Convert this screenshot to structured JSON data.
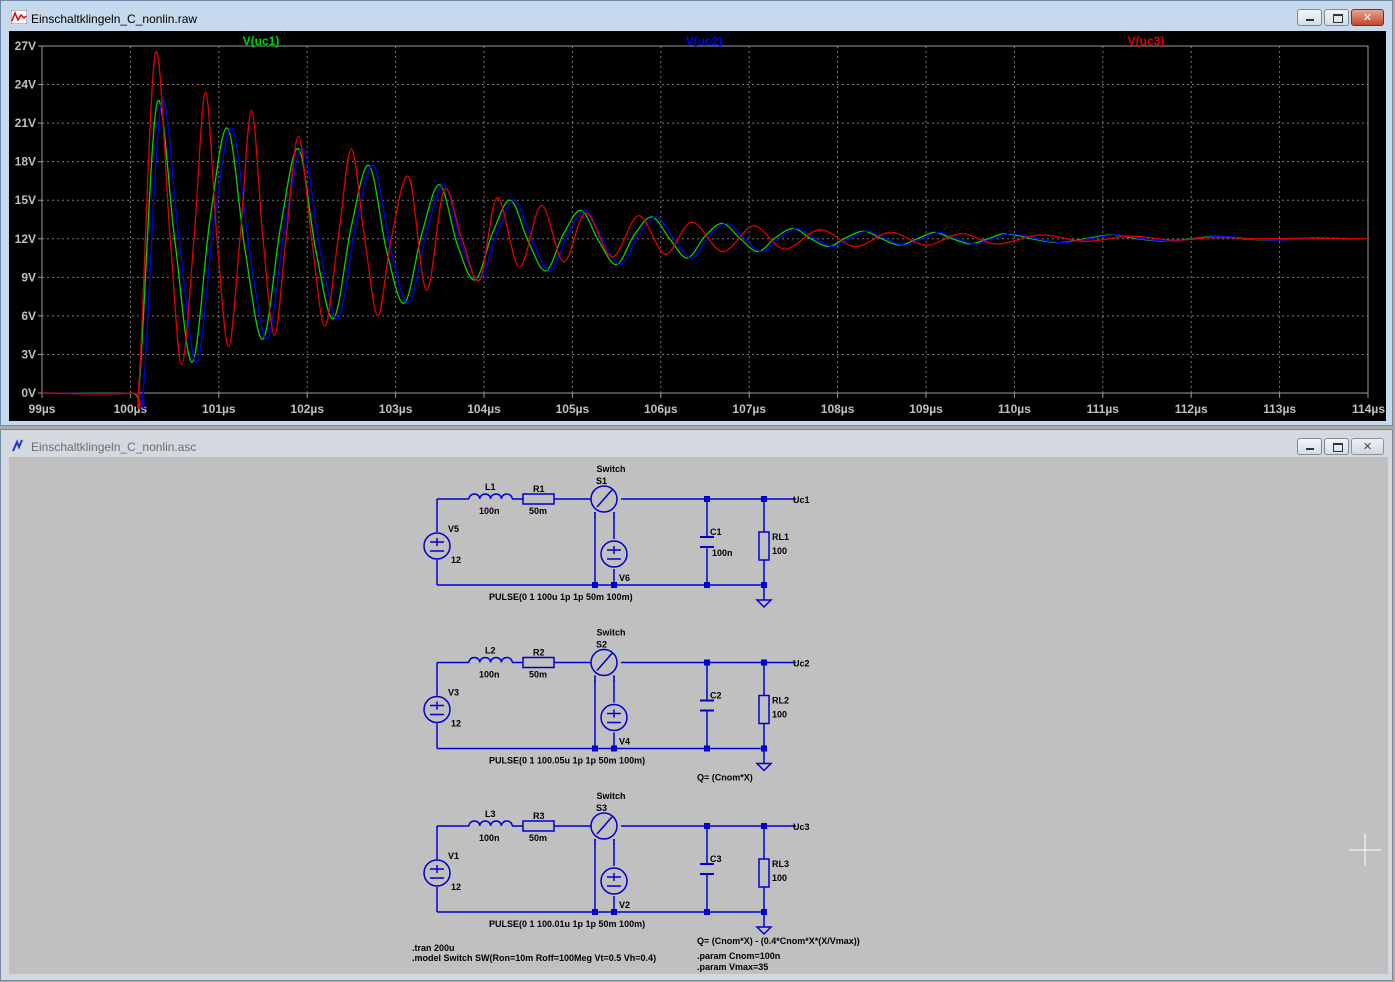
{
  "plot_window": {
    "title": "Einschaltklingeln_C_nonlin.raw",
    "app_icon": "waveform-icon",
    "controls": {
      "minimize": "minimize-icon",
      "maximize": "maximize-icon",
      "close_label": "✕"
    }
  },
  "schematic_window": {
    "title": "Einschaltklingeln_C_nonlin.asc",
    "app_icon": "schematic-icon",
    "controls": {
      "minimize": "minimize-icon",
      "maximize": "maximize-icon",
      "close_label": "✕"
    }
  },
  "chart_data": {
    "type": "line",
    "title": "",
    "xlabel": "",
    "ylabel": "",
    "xlim": [
      99,
      114
    ],
    "ylim": [
      0,
      27
    ],
    "x_unit": "µs",
    "y_unit": "V",
    "x_ticks": [
      "99µs",
      "100µs",
      "101µs",
      "102µs",
      "103µs",
      "104µs",
      "105µs",
      "106µs",
      "107µs",
      "108µs",
      "109µs",
      "110µs",
      "111µs",
      "112µs",
      "113µs",
      "114µs"
    ],
    "y_ticks": [
      "0V",
      "3V",
      "6V",
      "9V",
      "12V",
      "15V",
      "18V",
      "21V",
      "24V",
      "27V"
    ],
    "grid": true,
    "background": "#000000",
    "series": [
      {
        "name": "V(uc1)",
        "color": "#00d400",
        "x": [
          99,
          100.0,
          100.1,
          100.3,
          100.5,
          100.7,
          100.9,
          101.1,
          101.3,
          101.5,
          101.7,
          101.9,
          102.1,
          102.3,
          102.5,
          102.7,
          102.9,
          103.1,
          103.3,
          103.5,
          103.7,
          103.9,
          104.1,
          104.3,
          104.5,
          104.7,
          104.9,
          105.1,
          105.3,
          105.5,
          105.7,
          105.9,
          106.1,
          106.3,
          106.5,
          106.7,
          106.9,
          107.1,
          107.3,
          107.5,
          107.7,
          107.9,
          108.1,
          108.3,
          108.5,
          108.7,
          108.9,
          109.1,
          109.3,
          109.5,
          109.7,
          109.9,
          110.2,
          110.5,
          110.8,
          111.1,
          111.4,
          111.7,
          112.0,
          112.3,
          112.6,
          112.9,
          113.2,
          113.5,
          113.8,
          114
        ],
        "y": [
          0,
          0,
          0.6,
          22.5,
          12.0,
          2.4,
          13.5,
          20.6,
          11.0,
          4.2,
          13.0,
          19.0,
          11.0,
          5.8,
          13.0,
          17.7,
          11.0,
          7.0,
          12.5,
          16.2,
          11.5,
          8.8,
          12.5,
          15.0,
          11.8,
          9.5,
          12.4,
          14.2,
          11.8,
          10.0,
          12.3,
          13.7,
          12.0,
          10.5,
          12.2,
          13.2,
          12.0,
          11.0,
          12.1,
          12.8,
          12.0,
          11.4,
          12.1,
          12.6,
          12.0,
          11.5,
          12.0,
          12.5,
          12.0,
          11.6,
          12.0,
          12.4,
          12.0,
          11.7,
          12.0,
          12.3,
          12.0,
          11.8,
          12.0,
          12.2,
          12.0,
          11.9,
          12.0,
          12.1,
          12.0,
          12.0
        ]
      },
      {
        "name": "V(uc2)",
        "color": "#0000f0",
        "x": [
          99,
          100.05,
          100.15,
          100.35,
          100.55,
          100.75,
          100.95,
          101.15,
          101.35,
          101.55,
          101.75,
          101.95,
          102.15,
          102.35,
          102.55,
          102.75,
          102.95,
          103.15,
          103.35,
          103.55,
          103.75,
          103.95,
          104.15,
          104.35,
          104.55,
          104.75,
          104.95,
          105.15,
          105.35,
          105.55,
          105.75,
          105.95,
          106.15,
          106.35,
          106.55,
          106.75,
          106.95,
          107.15,
          107.35,
          107.55,
          107.75,
          107.95,
          108.15,
          108.35,
          108.55,
          108.75,
          108.95,
          109.15,
          109.35,
          109.55,
          109.75,
          109.95,
          110.25,
          110.55,
          110.85,
          111.15,
          111.45,
          111.75,
          112.05,
          112.35,
          112.65,
          112.95,
          113.25,
          113.55,
          113.85,
          114
        ],
        "y": [
          0,
          0,
          0.6,
          22.5,
          12.0,
          2.4,
          13.5,
          20.6,
          11.0,
          4.2,
          13.0,
          19.0,
          11.0,
          5.8,
          13.0,
          17.7,
          11.0,
          7.0,
          12.5,
          16.2,
          11.5,
          8.8,
          12.5,
          15.0,
          11.8,
          9.5,
          12.4,
          14.2,
          11.8,
          10.0,
          12.3,
          13.7,
          12.0,
          10.5,
          12.2,
          13.2,
          12.0,
          11.0,
          12.1,
          12.8,
          12.0,
          11.4,
          12.1,
          12.6,
          12.0,
          11.5,
          12.0,
          12.5,
          12.0,
          11.6,
          12.0,
          12.4,
          12.0,
          11.7,
          12.0,
          12.3,
          12.0,
          11.8,
          12.0,
          12.2,
          12.0,
          11.9,
          12.0,
          12.1,
          12.0,
          12.0
        ]
      },
      {
        "name": "V(uc3)",
        "color": "#e00000",
        "x": [
          99,
          100.01,
          100.1,
          100.28,
          100.45,
          100.58,
          100.72,
          100.85,
          100.98,
          101.11,
          101.24,
          101.37,
          101.5,
          101.63,
          101.76,
          101.9,
          102.05,
          102.2,
          102.35,
          102.5,
          102.65,
          102.8,
          102.95,
          103.15,
          103.35,
          103.55,
          103.75,
          103.95,
          104.15,
          104.4,
          104.65,
          104.9,
          105.15,
          105.45,
          105.75,
          106.05,
          106.35,
          106.7,
          107.05,
          107.4,
          107.8,
          108.2,
          108.6,
          109.0,
          109.4,
          109.8,
          110.3,
          110.8,
          111.3,
          111.8,
          112.3,
          112.8,
          113.3,
          114
        ],
        "y": [
          0,
          0,
          1.0,
          26.4,
          12.0,
          2.2,
          12.0,
          23.4,
          12.0,
          3.6,
          12.0,
          22.0,
          12.0,
          4.5,
          12.0,
          20.0,
          12.0,
          5.2,
          12.0,
          19.0,
          12.0,
          6.0,
          12.0,
          16.8,
          8.0,
          15.8,
          12.0,
          8.8,
          15.2,
          9.8,
          14.6,
          10.2,
          14.0,
          10.6,
          13.8,
          10.8,
          13.3,
          11.0,
          13.0,
          11.2,
          12.7,
          11.4,
          12.5,
          11.5,
          12.4,
          11.6,
          12.3,
          11.8,
          12.2,
          11.9,
          12.1,
          12.0,
          12.05,
          12.0
        ]
      }
    ]
  },
  "schematic": {
    "cells": [
      {
        "switch_model": "Switch",
        "switch": "S1",
        "inductor": "L1",
        "inductor_val": "100n",
        "resistor": "R1",
        "resistor_val": "50m",
        "source": "V5",
        "source_val": "12",
        "ctrl_source": "V6",
        "pulse": "PULSE(0 1 100u 1p 1p 50m 100m)",
        "cap": "C1",
        "cap_val": "100n",
        "load": "RL1",
        "load_val": "100",
        "node": "Uc1",
        "cap_expr": ""
      },
      {
        "switch_model": "Switch",
        "switch": "S2",
        "inductor": "L2",
        "inductor_val": "100n",
        "resistor": "R2",
        "resistor_val": "50m",
        "source": "V3",
        "source_val": "12",
        "ctrl_source": "V4",
        "pulse": "PULSE(0 1 100.05u 1p 1p 50m 100m)",
        "cap": "C2",
        "cap_val": "",
        "load": "RL2",
        "load_val": "100",
        "node": "Uc2",
        "cap_expr": "Q= (Cnom*X)"
      },
      {
        "switch_model": "Switch",
        "switch": "S3",
        "inductor": "L3",
        "inductor_val": "100n",
        "resistor": "R3",
        "resistor_val": "50m",
        "source": "V1",
        "source_val": "12",
        "ctrl_source": "V2",
        "pulse": "PULSE(0 1 100.01u 1p 1p 50m 100m)",
        "cap": "C3",
        "cap_val": "",
        "load": "RL3",
        "load_val": "100",
        "node": "Uc3",
        "cap_expr": "Q= (Cnom*X) - (0.4*Cnom*X*(X/Vmax))"
      }
    ],
    "directives": {
      "tran": ".tran 200u",
      "model": ".model Switch  SW(Ron=10m Roff=100Meg Vt=0.5 Vh=0.4)",
      "param1": ".param Cnom=100n",
      "param2": ".param Vmax=35"
    },
    "wire_color": "#0000d0",
    "cursor": "crosshair-cursor-icon"
  }
}
